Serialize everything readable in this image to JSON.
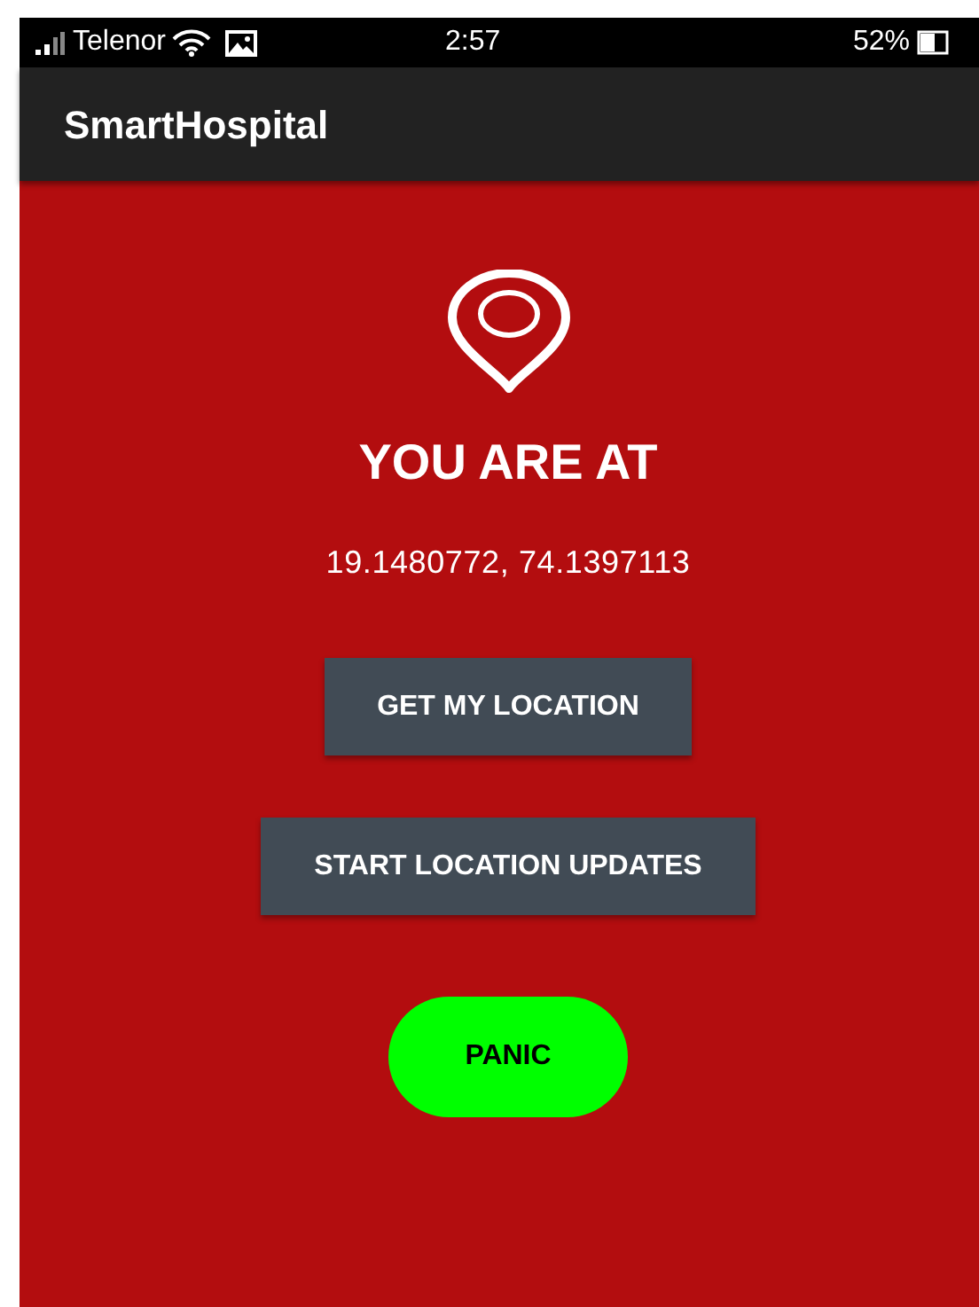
{
  "status_bar": {
    "carrier": "Telenor",
    "time": "2:57",
    "battery": "52%"
  },
  "app_bar": {
    "title": "SmartHospital"
  },
  "location": {
    "heading": "YOU ARE AT",
    "coordinates": "19.1480772, 74.1397113"
  },
  "buttons": [
    {
      "label": "GET MY LOCATION",
      "kind": "action"
    },
    {
      "label": "START LOCATION UPDATES",
      "kind": "action"
    },
    {
      "label": "PANIC",
      "kind": "panic"
    }
  ]
}
